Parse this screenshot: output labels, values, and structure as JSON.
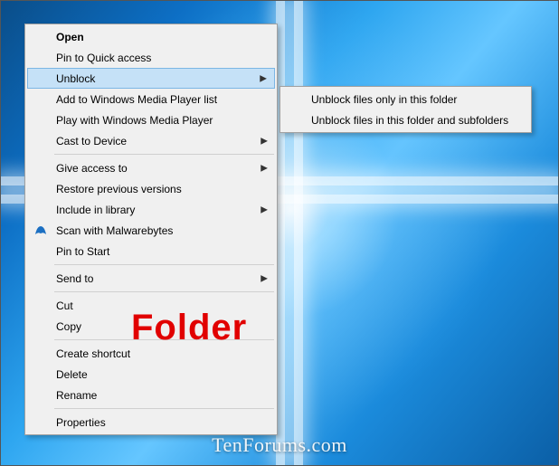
{
  "menu": {
    "items": [
      {
        "label": "Open",
        "bold": true
      },
      {
        "label": "Pin to Quick access"
      },
      {
        "label": "Unblock",
        "submenu": true,
        "hover": true
      },
      {
        "label": "Add to Windows Media Player list"
      },
      {
        "label": "Play with Windows Media Player"
      },
      {
        "label": "Cast to Device",
        "submenu": true
      },
      {
        "sep": true
      },
      {
        "label": "Give access to",
        "submenu": true
      },
      {
        "label": "Restore previous versions"
      },
      {
        "label": "Include in library",
        "submenu": true
      },
      {
        "label": "Scan with Malwarebytes",
        "icon": "malwarebytes"
      },
      {
        "label": "Pin to Start"
      },
      {
        "sep": true
      },
      {
        "label": "Send to",
        "submenu": true
      },
      {
        "sep": true
      },
      {
        "label": "Cut"
      },
      {
        "label": "Copy"
      },
      {
        "sep": true
      },
      {
        "label": "Create shortcut"
      },
      {
        "label": "Delete"
      },
      {
        "label": "Rename"
      },
      {
        "sep": true
      },
      {
        "label": "Properties"
      }
    ]
  },
  "submenu": {
    "items": [
      {
        "label": "Unblock files only in this folder"
      },
      {
        "label": "Unblock files in this folder and subfolders"
      }
    ]
  },
  "overlay_label": "Folder",
  "watermark": "TenForums.com"
}
